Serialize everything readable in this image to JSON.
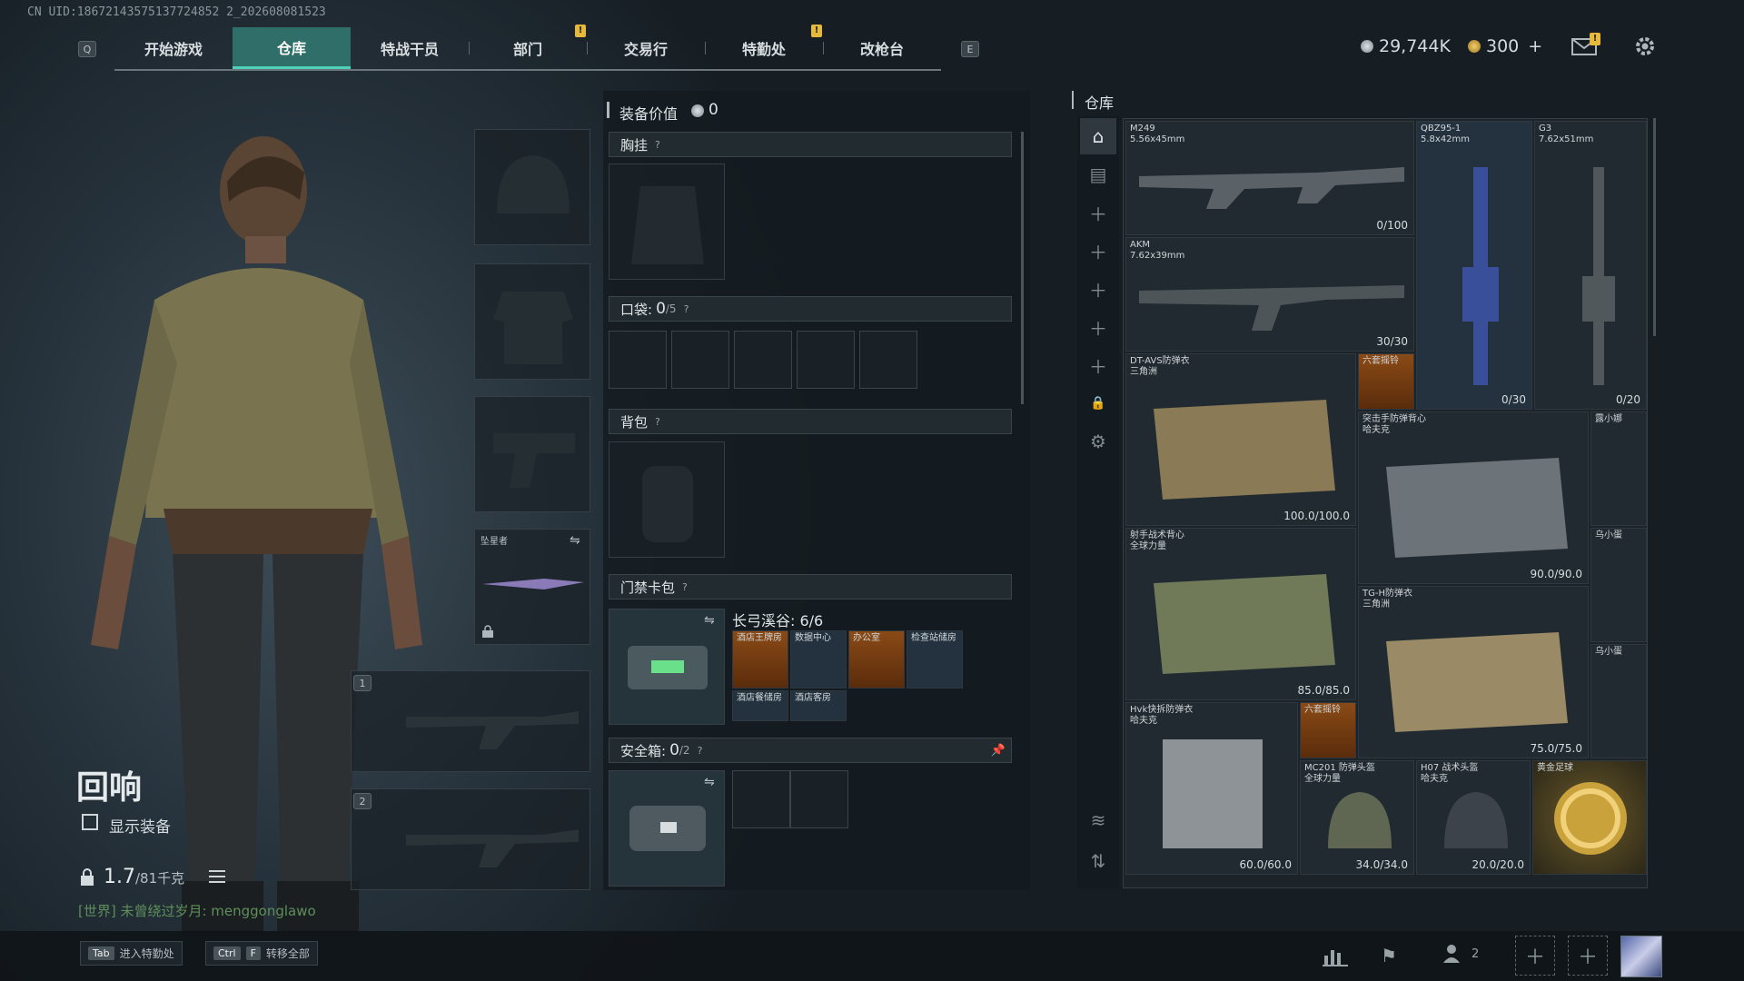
{
  "uid": "CN UID:18672143575137724852 2_202608081523",
  "nav": {
    "left_key": "Q",
    "right_key": "E",
    "tabs": [
      "开始游戏",
      "仓库",
      "特战干员",
      "部门",
      "交易行",
      "特勤处",
      "改枪台"
    ],
    "active_tab": "仓库"
  },
  "currency": {
    "silver": "29,744K",
    "gold": "300",
    "plus": "+"
  },
  "colors": {
    "accent": "#2f6e69",
    "accent_line": "#4fd0b8",
    "badge": "#e6b93a"
  },
  "operator": {
    "name": "回响",
    "show_equipment": "显示装备",
    "weight": "1.7",
    "weight_cap": "/81千克",
    "world_chat": "[世界] 未曾绕过岁月: menggonglawo"
  },
  "equip_slots": {
    "melee_name": "坠星者",
    "weapon_slot_1": "1",
    "weapon_slot_2": "2"
  },
  "loadout": {
    "value_label": "装备价值",
    "value": "0",
    "chest_rig": "胸挂",
    "pockets_label": "口袋:",
    "pockets_count": "0",
    "pockets_cap": "/5",
    "backpack": "背包",
    "keycard_label": "门禁卡包",
    "keycard_set": "长弓溪谷: 6/6",
    "keycards": [
      "酒店王牌房",
      "数据中心",
      "办公室",
      "检查站储房",
      "酒店餐储房",
      "酒店客房"
    ],
    "safebox_label": "安全箱:",
    "safebox_count": "0",
    "safebox_cap": "/2",
    "help": "?"
  },
  "stash": {
    "title": "仓库",
    "items": [
      {
        "name": "M249",
        "sub": "5.56x45mm",
        "dur": "0/100"
      },
      {
        "name": "QBZ95-1",
        "sub": "5.8x42mm",
        "dur": "0/30"
      },
      {
        "name": "G3",
        "sub": "7.62x51mm",
        "dur": "0/20"
      },
      {
        "name": "AKM",
        "sub": "7.62x39mm",
        "dur": "30/30"
      },
      {
        "name": "DT-AVS防弹衣",
        "sub": "三角洲",
        "dur": "100.0/100.0"
      },
      {
        "name": "六套摇铃",
        "sub": "",
        "dur": ""
      },
      {
        "name": "突击手防弹背心",
        "sub": "哈夫克",
        "dur": "90.0/90.0"
      },
      {
        "name": "露小娜",
        "sub": "",
        "dur": ""
      },
      {
        "name": "射手战术背心",
        "sub": "全球力量",
        "dur": "85.0/85.0"
      },
      {
        "name": "乌小蛋",
        "sub": "",
        "dur": ""
      },
      {
        "name": "TG-H防弹衣",
        "sub": "三角洲",
        "dur": "75.0/75.0"
      },
      {
        "name": "乌小蛋",
        "sub": "",
        "dur": ""
      },
      {
        "name": "Hvk快拆防弹衣",
        "sub": "哈夫克",
        "dur": "60.0/60.0"
      },
      {
        "name": "六套摇铃",
        "sub": "",
        "dur": ""
      },
      {
        "name": "MC201 防弹头盔",
        "sub": "全球力量",
        "dur": "34.0/34.0"
      },
      {
        "name": "H07 战术头盔",
        "sub": "哈夫克",
        "dur": "20.0/20.0"
      },
      {
        "name": "黄金足球",
        "sub": "",
        "dur": ""
      }
    ]
  },
  "bottom": {
    "hint1_key": "Tab",
    "hint1": "进入特勤处",
    "hint2_key1": "Ctrl",
    "hint2_key2": "F",
    "hint2": "转移全部",
    "squad_count": "2"
  }
}
